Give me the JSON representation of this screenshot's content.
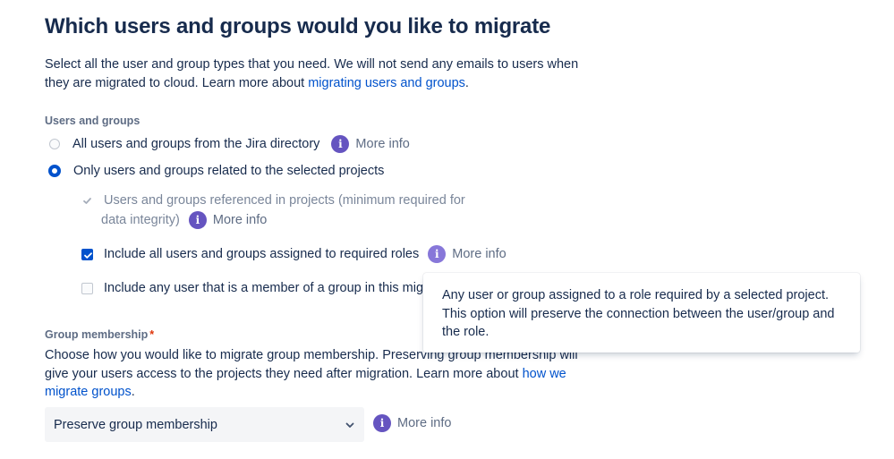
{
  "page": {
    "title": "Which users and groups would you like to migrate",
    "intro_text": "Select all the user and group types that you need. We will not send any emails to users when they are migrated to cloud. Learn more about ",
    "intro_link": "migrating users and groups",
    "intro_end": "."
  },
  "users_groups": {
    "label": "Users and groups",
    "option_all": {
      "label": "All users and groups from the Jira directory",
      "selected": false
    },
    "option_related": {
      "label": "Only users and groups related to the selected projects",
      "selected": true
    },
    "more_info": "More info",
    "sub_options": [
      {
        "line1": "Users and groups referenced in projects (minimum required for",
        "line2": "data integrity)",
        "checked": true,
        "disabled": true
      },
      {
        "label": "Include all users and groups assigned to required roles",
        "checked": true,
        "disabled": false
      },
      {
        "label": "Include any user that is a member of a group in this migr",
        "checked": false,
        "disabled": false
      }
    ]
  },
  "tooltip": {
    "text": "Any user or group assigned to a role required by a selected project. This option will preserve the connection between the user/group and the role."
  },
  "group_membership": {
    "label": "Group membership",
    "required_mark": "*",
    "desc_text": "Choose how you would like to migrate group membership. Preserving group membership will give your users access to the projects they need after migration. Learn more about ",
    "desc_link": "how we migrate groups",
    "desc_end": ".",
    "select_value": "Preserve group membership",
    "more_info": "More info"
  },
  "colors": {
    "accent": "#0052cc",
    "info_icon": "#6554c0",
    "text": "#172b4d",
    "muted": "#5e6c84",
    "required": "#de350b"
  }
}
